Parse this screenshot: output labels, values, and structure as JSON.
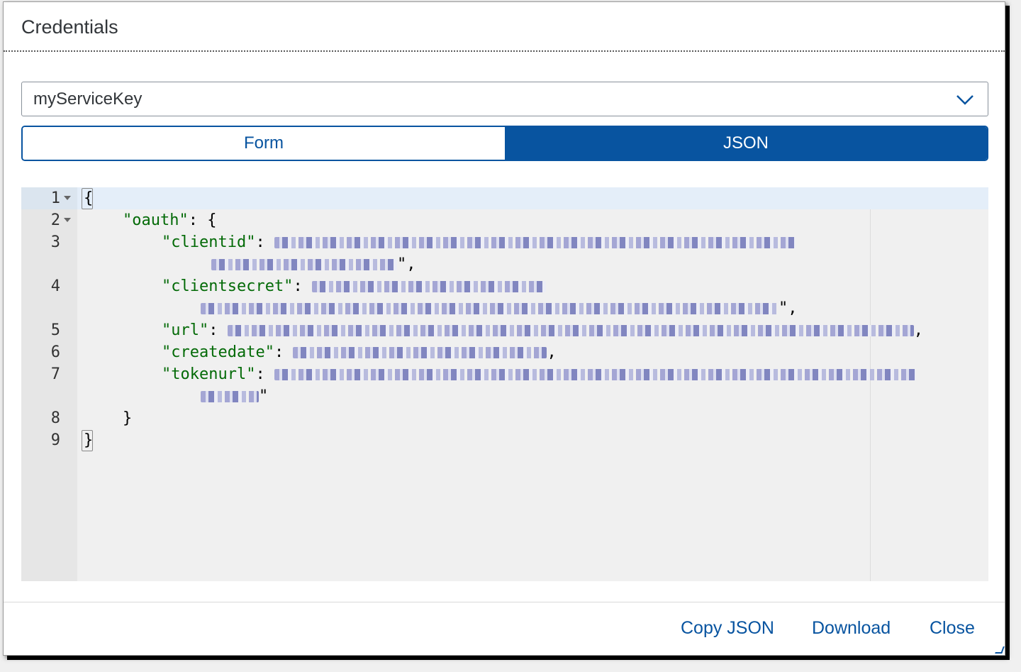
{
  "dialog": {
    "title": "Credentials"
  },
  "select": {
    "value": "myServiceKey",
    "icon": "chevron-down-icon"
  },
  "toggle": {
    "form_label": "Form",
    "json_label": "JSON",
    "selected": "JSON"
  },
  "editor": {
    "line_numbers": [
      "1",
      "2",
      "3",
      "4",
      "5",
      "6",
      "7",
      "8",
      "9"
    ],
    "keys": {
      "oauth": "\"oauth\"",
      "clientid": "\"clientid\"",
      "clientsecret": "\"clientsecret\"",
      "url": "\"url\"",
      "createdate": "\"createdate\"",
      "tokenurl": "\"tokenurl\""
    },
    "open_brace": "{",
    "close_brace": "}",
    "colon_brace": ": {",
    "colon": ": ",
    "comma": ",",
    "quote": "\"",
    "quote_comma": "\","
  },
  "footer": {
    "copy_json": "Copy JSON",
    "download": "Download",
    "close": "Close"
  },
  "colors": {
    "accent": "#0854a0",
    "json_key": "#036a07",
    "editor_bg": "#f0f0f0",
    "gutter_bg": "#e6e6e6"
  }
}
